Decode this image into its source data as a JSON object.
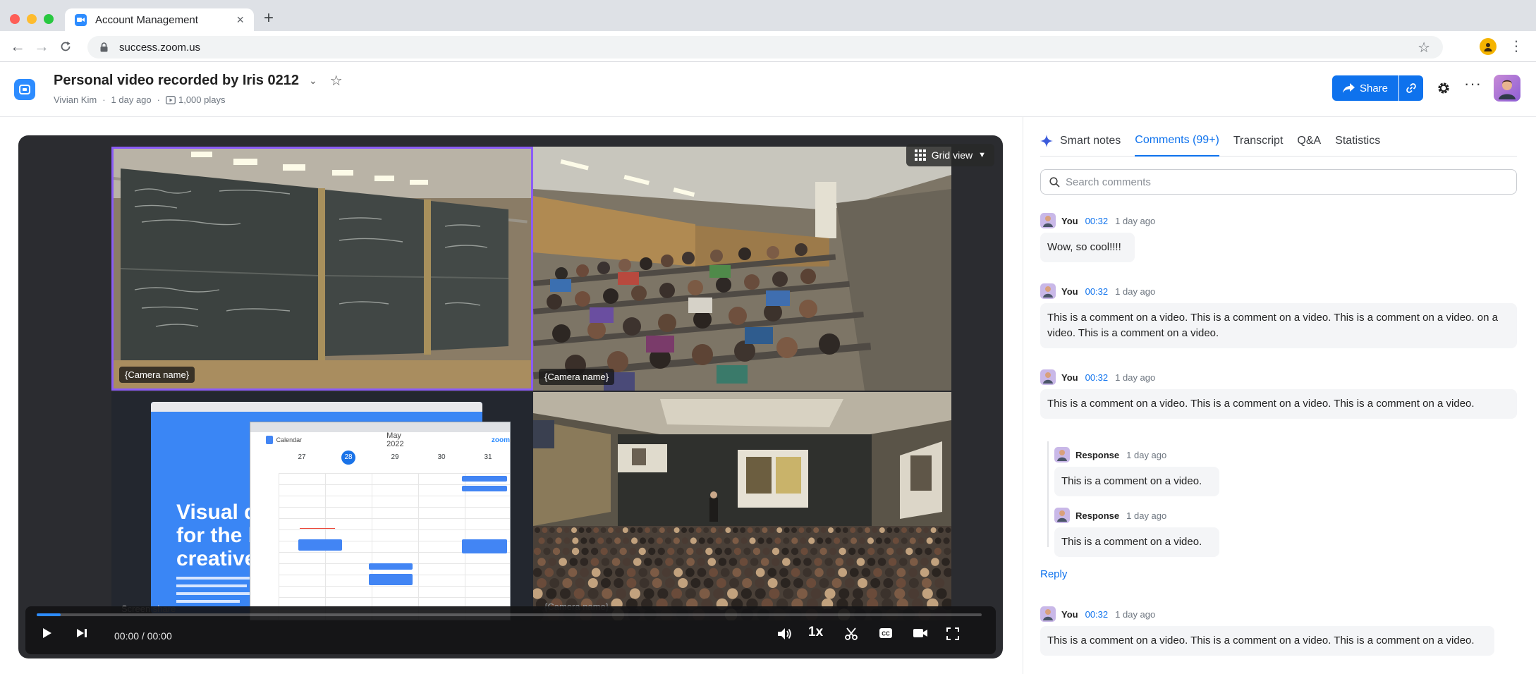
{
  "browser": {
    "tab_title": "Account Management",
    "url": "success.zoom.us"
  },
  "header": {
    "title": "Personal video recorded by Iris 0212",
    "owner": "Vivian Kim",
    "age": "1 day ago",
    "plays": "1,000 plays",
    "share_label": "Share"
  },
  "player": {
    "grid_view_label": "Grid view",
    "tiles": [
      {
        "label": "{Camera name}"
      },
      {
        "label": "{Camera name}"
      },
      {
        "label": "Screen share"
      },
      {
        "label": "{Camera name}"
      }
    ],
    "time": "00:00 / 00:00",
    "speed": "1x",
    "progress": 0.025,
    "screen": {
      "app": "Calendar",
      "month": "May 2022",
      "headline": "Visual d\nfor the b\ncreative",
      "days": [
        "27",
        "28",
        "29",
        "30",
        "31"
      ]
    }
  },
  "panel": {
    "tabs": [
      {
        "label": "Smart notes"
      },
      {
        "label": "Comments (99+)",
        "active": true
      },
      {
        "label": "Transcript"
      },
      {
        "label": "Q&A"
      },
      {
        "label": "Statistics"
      }
    ],
    "search_placeholder": "Search comments",
    "comments": [
      {
        "name": "You",
        "time": "00:32",
        "ago": "1 day ago",
        "text": "Wow, so cool!!!!"
      },
      {
        "name": "You",
        "time": "00:32",
        "ago": "1 day ago",
        "text": "This is a comment on a video. This is a comment on a video. This is a comment on a video. on a video. This is a comment on a video."
      },
      {
        "name": "You",
        "time": "00:32",
        "ago": "1 day ago",
        "text": "This is a comment on a video. This is a comment on a video. This is a comment on a video."
      },
      {
        "name": "You",
        "time": "00:32",
        "ago": "1 day ago",
        "text": "This is a comment on a video. This is a comment on a video. This is a comment on a video."
      }
    ],
    "responses": [
      {
        "name": "Response",
        "ago": "1 day ago",
        "text": "This is a comment on a video."
      },
      {
        "name": "Response",
        "ago": "1 day ago",
        "text": "This is a comment on a video."
      }
    ],
    "reply_label": "Reply"
  },
  "colors": {
    "accent": "#0e72ed",
    "selected_tile": "#8b5cf6",
    "player_bg": "#2b2c30"
  }
}
